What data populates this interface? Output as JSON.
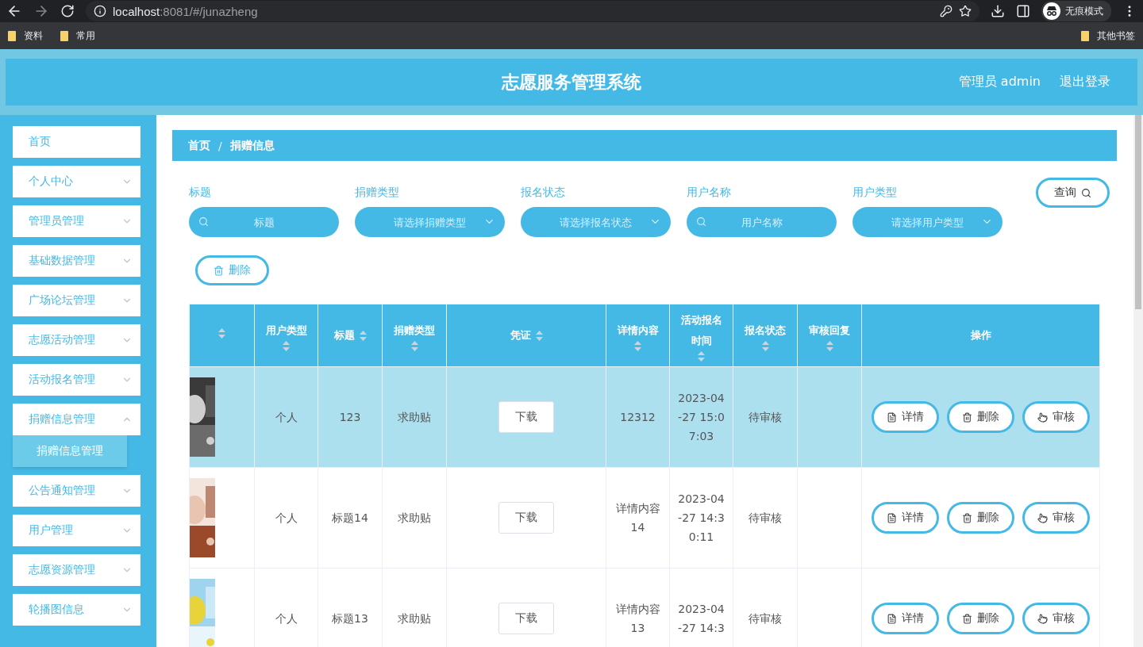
{
  "browser": {
    "url_host": "localhost",
    "url_rest": ":8081/#/junazheng",
    "profile": "无痕模式",
    "bookmarks": [
      "资料",
      "常用"
    ],
    "other_bookmarks": "其他书签"
  },
  "header": {
    "title": "志愿服务管理系统",
    "user": "管理员 admin",
    "logout": "退出登录"
  },
  "sidebar": {
    "items": [
      {
        "label": "首页",
        "expandable": false
      },
      {
        "label": "个人中心",
        "expandable": true,
        "expanded": false
      },
      {
        "label": "管理员管理",
        "expandable": true,
        "expanded": false
      },
      {
        "label": "基础数据管理",
        "expandable": true,
        "expanded": false
      },
      {
        "label": "广场论坛管理",
        "expandable": true,
        "expanded": false
      },
      {
        "label": "志愿活动管理",
        "expandable": true,
        "expanded": false
      },
      {
        "label": "活动报名管理",
        "expandable": true,
        "expanded": false
      },
      {
        "label": "捐赠信息管理",
        "expandable": true,
        "expanded": true,
        "children": [
          {
            "label": "捐赠信息管理",
            "selected": true
          }
        ]
      },
      {
        "label": "公告通知管理",
        "expandable": true,
        "expanded": false
      },
      {
        "label": "用户管理",
        "expandable": true,
        "expanded": false
      },
      {
        "label": "志愿资源管理",
        "expandable": true,
        "expanded": false
      },
      {
        "label": "轮播图信息",
        "expandable": true,
        "expanded": false
      }
    ]
  },
  "breadcrumb": {
    "items": [
      "首页",
      "捐赠信息"
    ],
    "separator": "/"
  },
  "filters": [
    {
      "label": "标题",
      "kind": "search",
      "placeholder": "标题"
    },
    {
      "label": "捐赠类型",
      "kind": "select",
      "placeholder": "请选择捐赠类型"
    },
    {
      "label": "报名状态",
      "kind": "select",
      "placeholder": "请选择报名状态"
    },
    {
      "label": "用户名称",
      "kind": "search",
      "placeholder": "用户名称"
    },
    {
      "label": "用户类型",
      "kind": "select",
      "placeholder": "请选择用户类型"
    }
  ],
  "query_button": "查询",
  "delete_button": "删除",
  "table": {
    "columns": [
      {
        "sortable": true
      },
      {
        "label": "用户类型",
        "sortable": true
      },
      {
        "label": "标题",
        "sortable": true
      },
      {
        "label": "捐赠类型",
        "sortable": true
      },
      {
        "label": "凭证",
        "sortable": true
      },
      {
        "label": "详情内容",
        "sortable": true
      },
      {
        "label": "活动报名时间",
        "sortable": true
      },
      {
        "label": "报名状态",
        "sortable": true
      },
      {
        "label": "审核回复",
        "sortable": true
      },
      {
        "label": "操作",
        "sortable": false
      }
    ],
    "rows": [
      {
        "selected": true,
        "user_type": "个人",
        "title": "123",
        "donation_type": "求助贴",
        "voucher": "下载",
        "detail": "12312",
        "time": "2023-04-27 15:07:03",
        "status": "待审核",
        "actions": [
          "详情",
          "删除",
          "审核"
        ]
      },
      {
        "selected": false,
        "user_type": "个人",
        "title": "标题14",
        "donation_type": "求助贴",
        "voucher": "下载",
        "detail": "详情内容14",
        "time": "2023-04-27 14:30:11",
        "status": "待审核",
        "actions": [
          "详情",
          "删除",
          "审核"
        ]
      },
      {
        "selected": false,
        "user_type": "个人",
        "title": "标题13",
        "donation_type": "求助贴",
        "voucher": "下载",
        "detail": "详情内容13",
        "time": "2023-04-27 14:3",
        "status": "待审核",
        "actions": [
          "详情",
          "删除",
          "审核"
        ]
      }
    ]
  }
}
